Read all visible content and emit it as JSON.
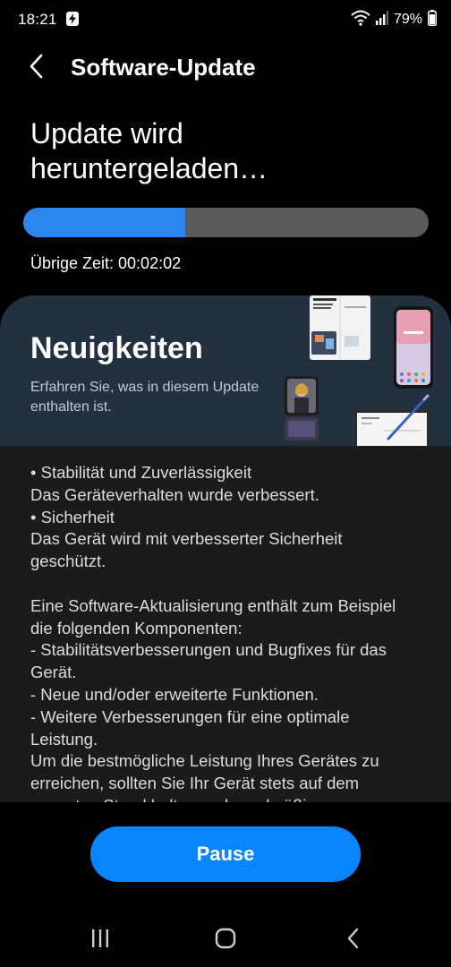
{
  "status_bar": {
    "time": "18:21",
    "battery_percent": "79%",
    "icons": [
      "data-saver-icon",
      "wifi-icon",
      "signal-icon",
      "battery-icon"
    ]
  },
  "app_bar": {
    "title": "Software-Update",
    "back_icon": "chevron-left-icon"
  },
  "download": {
    "headline": "Update wird\nheruntergeladen…",
    "progress_fraction": 0.4,
    "remaining_time": "Übrige Zeit: 00:02:02"
  },
  "news": {
    "title": "Neuigkeiten",
    "subtitle": "Erfahren Sie, was in diesem Update enthalten ist.",
    "notes": "• Stabilität und Zuverlässigkeit\nDas Geräteverhalten wurde verbessert.\n• Sicherheit\nDas Gerät wird mit verbesserter Sicherheit geschützt.\n\nEine Software-Aktualisierung enthält zum Beispiel die folgenden Komponenten:\n - Stabilitätsverbesserungen und Bugfixes für das Gerät.\n - Neue und/oder erweiterte Funktionen.\n - Weitere Verbesserungen für eine optimale Leistung.\nUm die bestmögliche Leistung Ihres Gerätes zu erreichen, sollten Sie Ihr Gerät stets auf dem neuesten Stand halten und regelmäßig"
  },
  "actions": {
    "pause_label": "Pause"
  },
  "nav_bar": {
    "items": [
      "recent-apps-icon",
      "home-icon",
      "back-icon"
    ]
  },
  "colors": {
    "accent": "#0a84ff",
    "progress_fill": "#2d85ee",
    "progress_track": "#5a5a5a",
    "banner_bg": "#23303f",
    "card_bg": "#1b1b1b"
  }
}
